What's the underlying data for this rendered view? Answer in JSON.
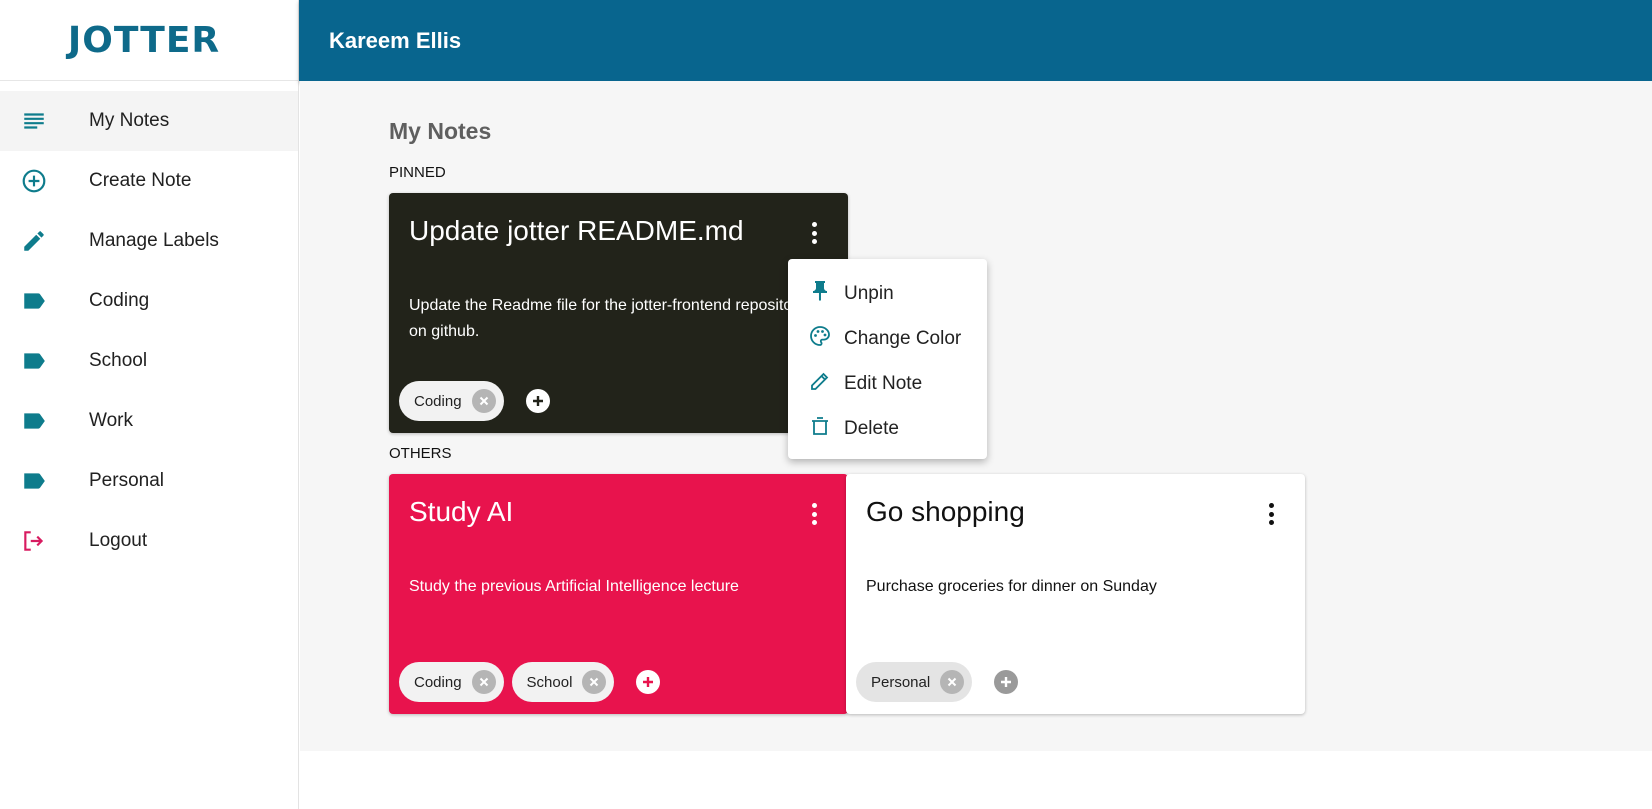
{
  "app": {
    "logo_text": "JOTTER"
  },
  "header": {
    "user_name": "Kareem Ellis"
  },
  "sidebar": {
    "items": [
      {
        "label": "My Notes",
        "icon": "notes-list-icon"
      },
      {
        "label": "Create Note",
        "icon": "add-circle-icon"
      },
      {
        "label": "Manage Labels",
        "icon": "pencil-icon"
      },
      {
        "label": "Coding",
        "icon": "label-tag-icon"
      },
      {
        "label": "School",
        "icon": "label-tag-icon"
      },
      {
        "label": "Work",
        "icon": "label-tag-icon"
      },
      {
        "label": "Personal",
        "icon": "label-tag-icon"
      },
      {
        "label": "Logout",
        "icon": "logout-icon"
      }
    ]
  },
  "main": {
    "title": "My Notes",
    "pinned_label": "PINNED",
    "others_label": "OTHERS",
    "pinned_notes": [
      {
        "title": "Update jotter README.md",
        "body": "Update the Readme file for the jotter-frontend repository on github.",
        "labels": [
          "Coding"
        ],
        "color": "#22231a"
      }
    ],
    "other_notes": [
      {
        "title": "Study AI",
        "body": "Study the previous Artificial Intelligence lecture",
        "labels": [
          "Coding",
          "School"
        ],
        "color": "#e8134d"
      },
      {
        "title": "Go shopping",
        "body": "Purchase groceries for dinner on Sunday",
        "labels": [
          "Personal"
        ],
        "color": "#ffffff"
      }
    ]
  },
  "context_menu": {
    "items": [
      {
        "label": "Unpin",
        "icon": "pin-icon"
      },
      {
        "label": "Change Color",
        "icon": "palette-icon"
      },
      {
        "label": "Edit Note",
        "icon": "pencil-icon"
      },
      {
        "label": "Delete",
        "icon": "trash-icon"
      }
    ]
  },
  "colors": {
    "accent": "#0e7c8c",
    "header": "#08658e",
    "logout": "#d81b60"
  }
}
